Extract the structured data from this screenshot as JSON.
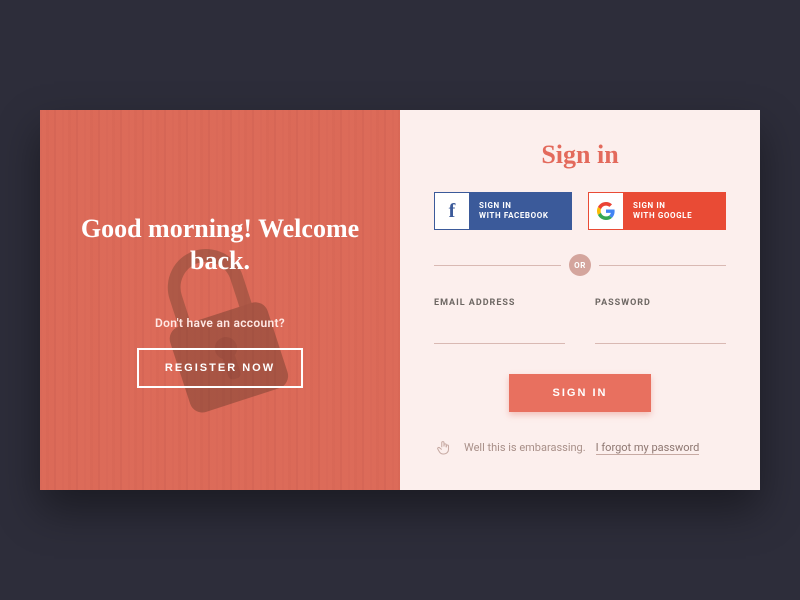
{
  "left": {
    "greeting": "Good morning!\nWelcome back.",
    "no_account_prompt": "Don't have an account?",
    "register_label": "REGISTER NOW"
  },
  "right": {
    "title": "Sign in",
    "social": {
      "facebook_label": "SIGN IN\nWITH FACEBOOK",
      "google_label": "SIGN IN\nWITH GOOGLE"
    },
    "divider_label": "OR",
    "fields": {
      "email_label": "EMAIL ADDRESS",
      "email_value": "",
      "password_label": "PASSWORD",
      "password_value": ""
    },
    "signin_label": "SIGN IN",
    "footer": {
      "prefix": "Well this is embarassing. ",
      "forgot_label": "I forgot my password"
    }
  },
  "colors": {
    "accent": "#e36a5c",
    "facebook": "#3b5a9a",
    "google": "#e94b35",
    "panel_bg": "#fcefed",
    "page_bg": "#2d2d3a"
  }
}
